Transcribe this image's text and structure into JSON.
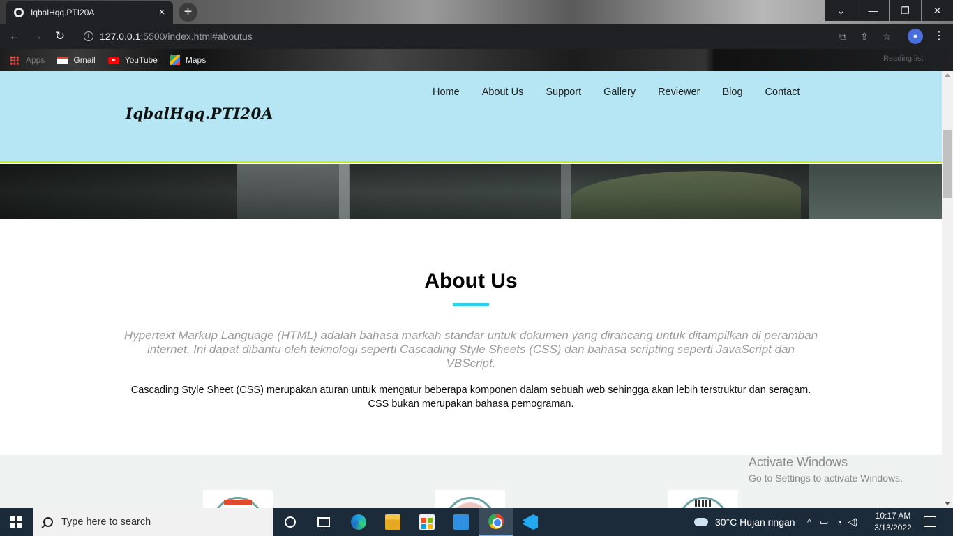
{
  "browser": {
    "tab_title": "IqbalHqq.PTI20A",
    "tab_close": "×",
    "new_tab": "+",
    "url_host": "127.0.0.1",
    "url_path": ":5500/index.html#aboutus",
    "window_controls": {
      "tabsearch": "⌄",
      "minimize": "—",
      "restore": "❐",
      "close": "✕"
    },
    "nav": {
      "back": "←",
      "forward": "→",
      "reload": "↻"
    },
    "bookmarks": [
      {
        "label": "Apps"
      },
      {
        "label": "Gmail"
      },
      {
        "label": "YouTube"
      },
      {
        "label": "Maps"
      }
    ],
    "reading_list": "Reading list"
  },
  "site": {
    "logo": "IqbalHqq.PTI20A",
    "nav": [
      "Home",
      "About Us",
      "Support",
      "Gallery",
      "Reviewer",
      "Blog",
      "Contact"
    ],
    "about": {
      "title": "About Us",
      "lead": "Hypertext Markup Language (HTML) adalah bahasa markah standar untuk dokumen yang dirancang untuk ditampilkan di peramban internet. Ini dapat dibantu oleh teknologi seperti Cascading Style Sheets (CSS) dan bahasa scripting seperti JavaScript dan VBScript.",
      "body": "Cascading Style Sheet (CSS) merupakan aturan untuk mengatur beberapa komponen dalam sebuah web sehingga akan lebih terstruktur dan seragam. CSS bukan merupakan bahasa pemograman."
    },
    "accent_color": "#2bd0ee",
    "header_color": "#b6e6f3"
  },
  "watermark": {
    "line1": "Activate Windows",
    "line2": "Go to Settings to activate Windows."
  },
  "taskbar": {
    "search_placeholder": "Type here to search",
    "weather": "30°C  Hujan ringan",
    "time": "10:17 AM",
    "date": "3/13/2022"
  }
}
